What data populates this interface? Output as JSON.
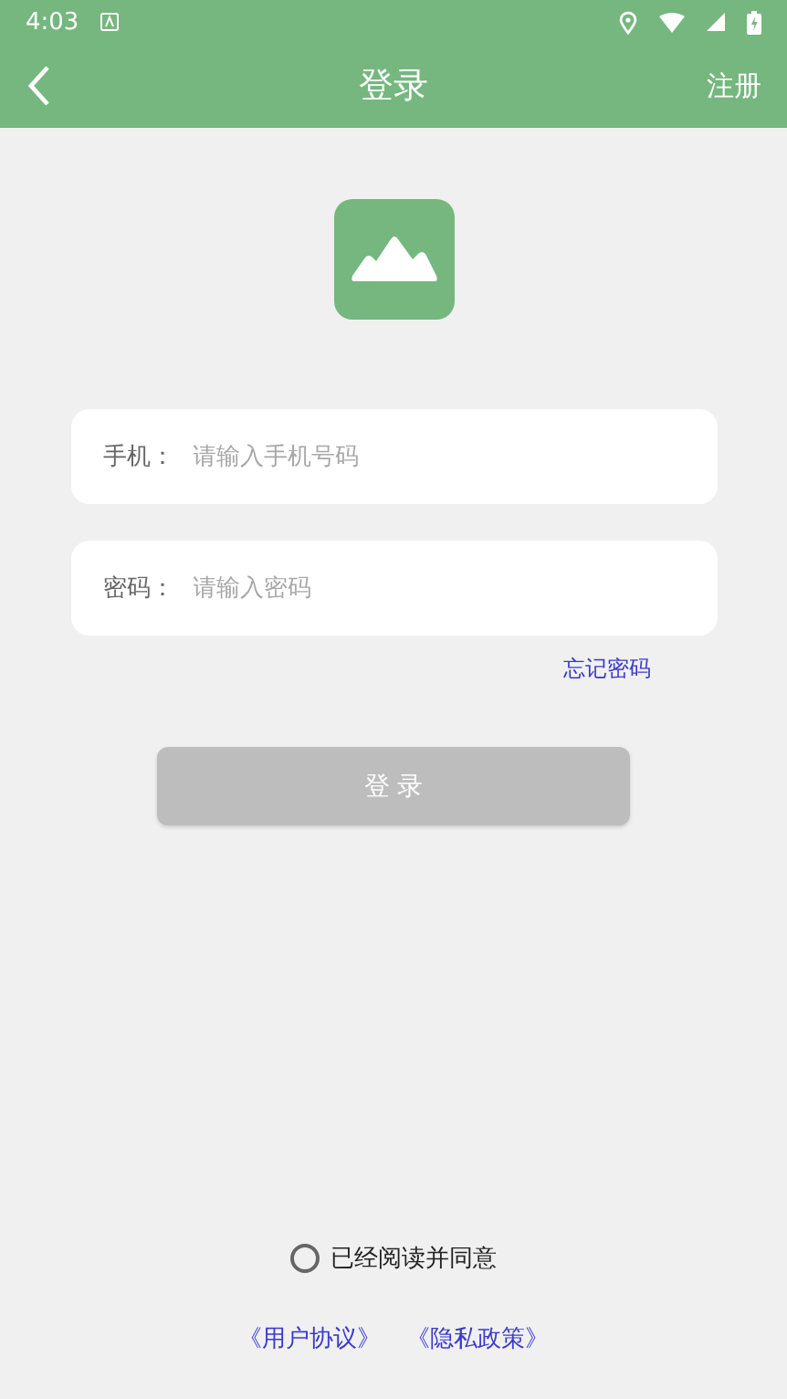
{
  "status_bar": {
    "time": "4:03"
  },
  "header": {
    "title": "登录",
    "action": "注册"
  },
  "fields": [
    {
      "label": "手机：",
      "placeholder": "请输入手机号码"
    },
    {
      "label": "密码：",
      "placeholder": "请输入密码"
    }
  ],
  "forgot_link": "忘记密码",
  "login_button": {
    "label": "登 录",
    "disabled": true
  },
  "agreement": {
    "label": "已经阅读并同意",
    "checked": false
  },
  "links": [
    "《用户协议》",
    "《隐私政策》"
  ]
}
